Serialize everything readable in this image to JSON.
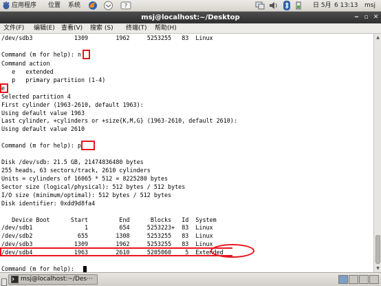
{
  "top_panel": {
    "menus": [
      "应用程序",
      "位置",
      "系统"
    ],
    "date": "日 5月",
    "time": "6 13:13",
    "user": "msj",
    "icons": [
      "gnome-foot-icon",
      "firefox-icon",
      "mail-icon",
      "help-icon",
      "network-icon",
      "volume-icon",
      "bluetooth-icon",
      "battery-icon"
    ]
  },
  "window": {
    "title": "msj@localhost:~/Desktop",
    "controls": [
      "minimize-icon",
      "maximize-icon",
      "close-icon"
    ]
  },
  "menubar": [
    "文件(F)",
    "编辑(E)",
    "查看(V)",
    "搜索 (S)",
    "终端(T)",
    "帮助(H)"
  ],
  "terminal": {
    "lines": [
      "/dev/sdb3            1309        1962     5253255   83  Linux",
      "",
      "Command (m for help): n",
      "Command action",
      "   e   extended",
      "   p   primary partition (1-4)",
      "e",
      "Selected partition 4",
      "First cylinder (1963-2610, default 1963):",
      "Using default value 1963",
      "Last cylinder, +cylinders or +size{K,M,G} (1963-2610, default 2610):",
      "Using default value 2610",
      "",
      "Command (m for help): p",
      "",
      "Disk /dev/sdb: 21.5 GB, 21474836480 bytes",
      "255 heads, 63 sectors/track, 2610 cylinders",
      "Units = cylinders of 16065 * 512 = 8225280 bytes",
      "Sector size (logical/physical): 512 bytes / 512 bytes",
      "I/O size (minimum/optimal): 512 bytes / 512 bytes",
      "Disk identifier: 0xdd9d8fa4",
      "",
      "   Device Boot      Start         End      Blocks   Id  System",
      "/dev/sdb1               1         654     5253223+  83  Linux",
      "/dev/sdb2             655        1308     5253255   83  Linux",
      "/dev/sdb3            1309        1962     5253255   83  Linux",
      "/dev/sdb4            1963        2610     5205060    5  Extended",
      "",
      "Command (m for help): "
    ],
    "highlight_color": "#e8141b"
  },
  "taskbar": {
    "task_label": "msj@localhost:~/Des···"
  }
}
